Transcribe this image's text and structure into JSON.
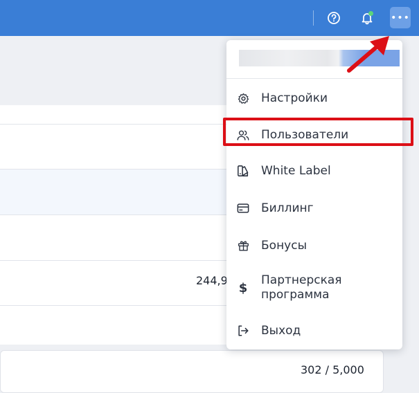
{
  "colors": {
    "topbar": "#3a7ed6",
    "accent_red": "#dc0f16",
    "notification_dot": "#5cd67a"
  },
  "topbar": {
    "icons": [
      "help-icon",
      "bell-icon",
      "more-icon"
    ],
    "more_label": "•••"
  },
  "background": {
    "rows": [
      {
        "value": ""
      },
      {
        "value": ""
      },
      {
        "value": ""
      },
      {
        "value": "244,9"
      },
      {
        "value": ""
      }
    ],
    "card_value": "302 / 5,000"
  },
  "menu": {
    "items": [
      {
        "label": "Настройки",
        "icon": "gear-icon"
      },
      {
        "label": "Пользователи",
        "icon": "users-icon",
        "highlighted": true
      },
      {
        "label": "White Label",
        "icon": "palette-icon"
      },
      {
        "label": "Биллинг",
        "icon": "credit-card-icon"
      },
      {
        "label": "Бонусы",
        "icon": "gift-icon"
      },
      {
        "label": "Партнерская программа",
        "icon": "dollar-icon"
      },
      {
        "label": "Выход",
        "icon": "logout-icon"
      }
    ]
  }
}
